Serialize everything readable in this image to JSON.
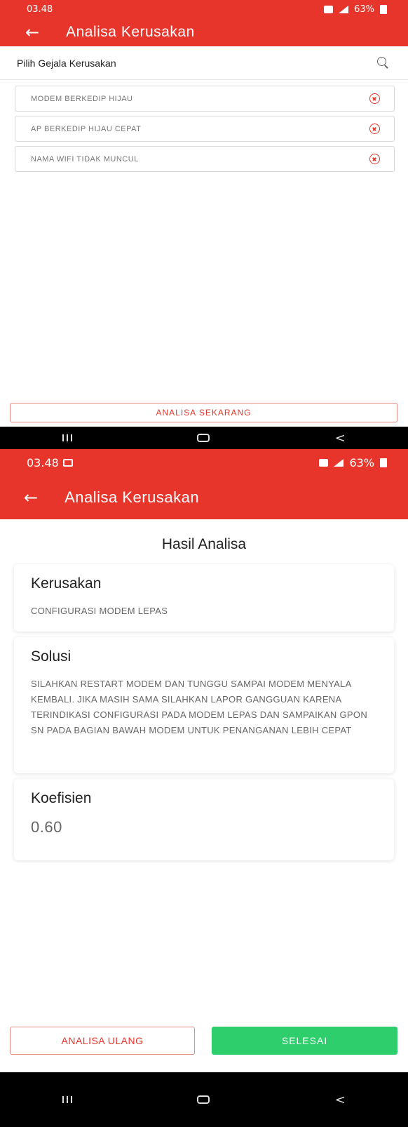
{
  "colors": {
    "accent": "#e8352b",
    "success": "#2fce6c"
  },
  "screen1": {
    "status_bar": {
      "time": "03.48",
      "battery": "63%"
    },
    "app_bar": {
      "title": "Analisa Kerusakan",
      "back_icon": "arrow-left-icon"
    },
    "search": {
      "label": "Pilih Gejala Kerusakan",
      "icon": "search-icon"
    },
    "symptoms": [
      {
        "label": "MODEM BERKEDIP HIJAU"
      },
      {
        "label": "AP BERKEDIP HIJAU CEPAT"
      },
      {
        "label": "NAMA WIFI TIDAK MUNCUL"
      }
    ],
    "analyze_button": "ANALISA SEKARANG"
  },
  "screen2": {
    "status_bar": {
      "time": "03.48",
      "battery": "63%"
    },
    "app_bar": {
      "title": "Analisa Kerusakan",
      "back_icon": "arrow-left-icon"
    },
    "result_title": "Hasil Analisa",
    "damage": {
      "heading": "Kerusakan",
      "value": "CONFIGURASI MODEM LEPAS"
    },
    "solution": {
      "heading": "Solusi",
      "value": "SILAHKAN RESTART MODEM DAN TUNGGU SAMPAI MODEM MENYALA KEMBALI. JIKA MASIH SAMA SILAHKAN LAPOR GANGGUAN KARENA TERINDIKASI CONFIGURASI PADA MODEM LEPAS DAN SAMPAIKAN GPON SN PADA BAGIAN BAWAH MODEM UNTUK PENANGANAN LEBIH CEPAT"
    },
    "coefficient": {
      "heading": "Koefisien",
      "value": "0.60"
    },
    "retry_button": "ANALISA ULANG",
    "done_button": "SELESAI"
  },
  "nav_bar": {
    "recents_icon": "recents-icon",
    "home_icon": "home-icon",
    "back_icon": "back-icon",
    "back_glyph": "<"
  }
}
